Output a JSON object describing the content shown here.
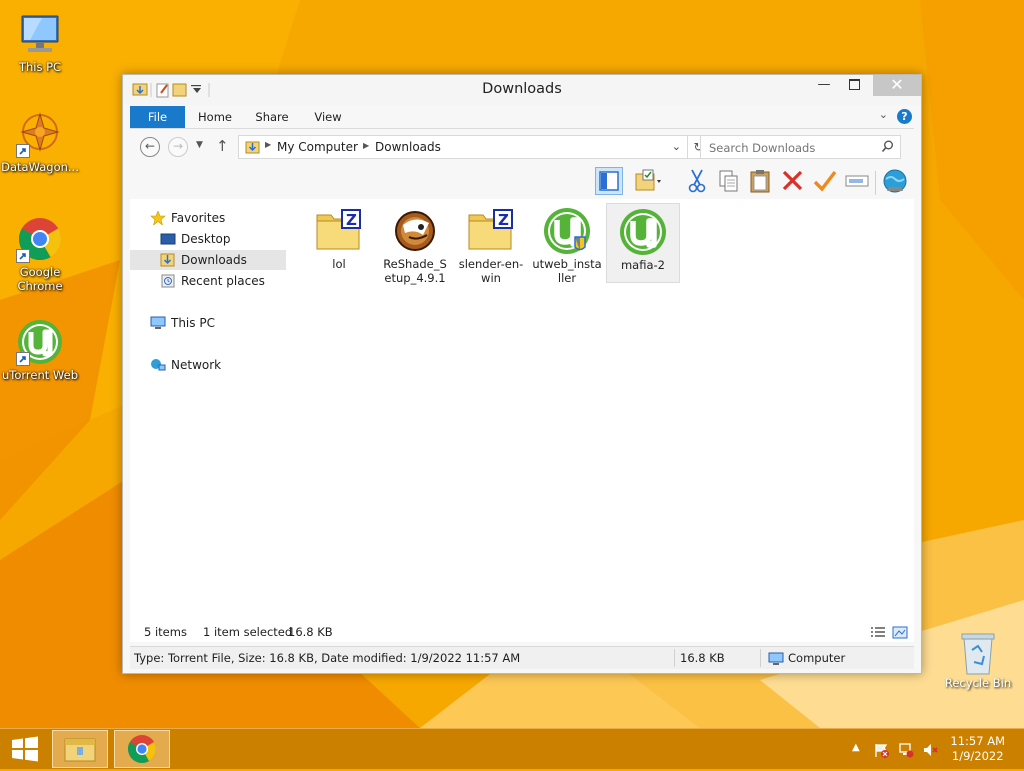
{
  "desktop": {
    "icons": [
      {
        "label": "This PC"
      },
      {
        "label": "DataWagon..."
      },
      {
        "label": "Google Chrome"
      },
      {
        "label": "uTorrent Web"
      }
    ],
    "recycle_bin": "Recycle Bin"
  },
  "window": {
    "title": "Downloads",
    "tabs": [
      {
        "label": "File"
      },
      {
        "label": "Home"
      },
      {
        "label": "Share"
      },
      {
        "label": "View"
      }
    ],
    "address": {
      "crumbs": [
        "My Computer",
        "Downloads"
      ]
    },
    "search": {
      "placeholder": "Search Downloads"
    },
    "nav_pane": {
      "favorites": "Favorites",
      "desktop": "Desktop",
      "downloads": "Downloads",
      "recent": "Recent places",
      "this_pc": "This PC",
      "network": "Network"
    },
    "files": [
      {
        "name": "lol",
        "icon": "winzip-archive-icon"
      },
      {
        "name": "ReShade_Setup_4.9.1",
        "icon": "reshade-icon"
      },
      {
        "name": "slender-en-win",
        "icon": "winzip-archive-icon"
      },
      {
        "name": "utweb_installer",
        "icon": "utorrent-installer-icon"
      },
      {
        "name": "mafia-2",
        "icon": "utorrent-file-icon",
        "selected": true
      }
    ],
    "status": {
      "items": "5 items",
      "selection": "1 item selected",
      "size": "16.8 KB",
      "details": "Type: Torrent File, Size: 16.8 KB, Date modified: 1/9/2022 11:57 AM",
      "details_size": "16.8 KB",
      "location": "Computer"
    }
  },
  "taskbar": {
    "time": "11:57 AM",
    "date": "1/9/2022"
  },
  "colors": {
    "accent": "#1979ca",
    "wallpaper": "#f6a800",
    "utorrent_green": "#56b33a"
  }
}
